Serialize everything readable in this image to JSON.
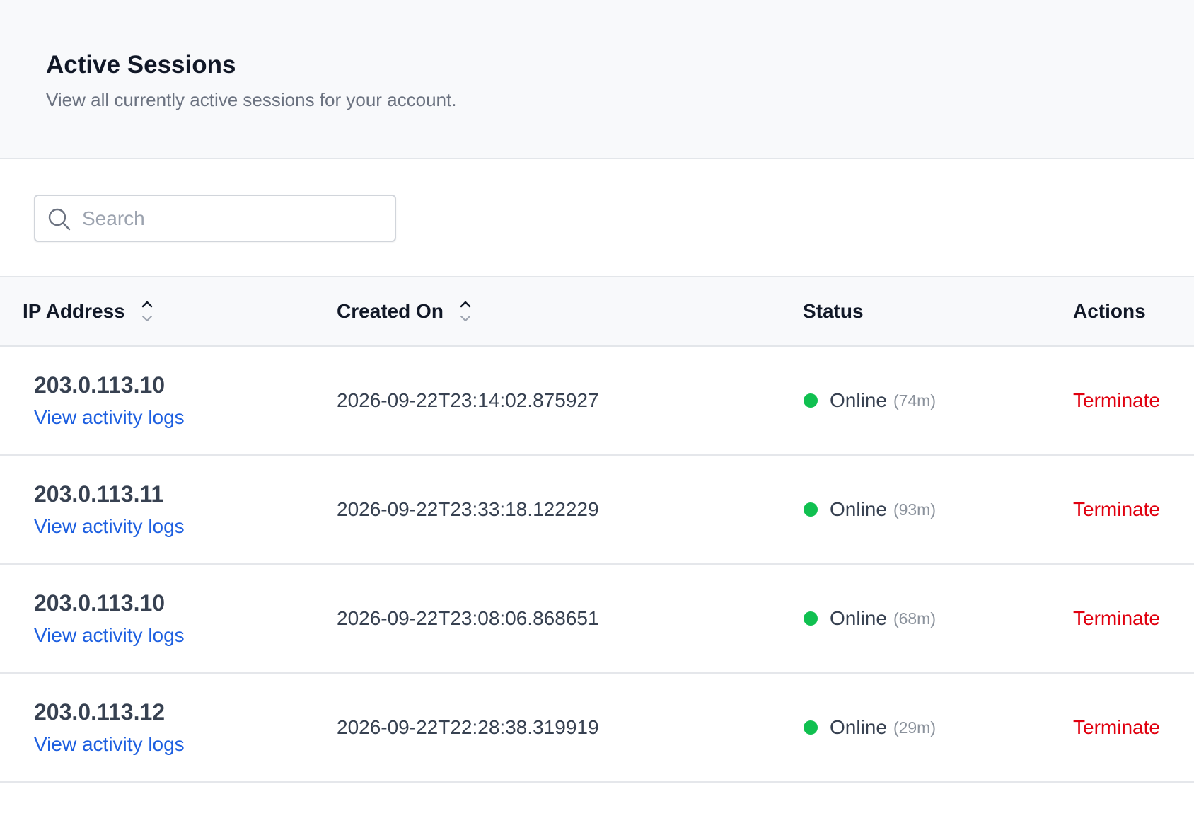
{
  "header": {
    "title": "Active Sessions",
    "subtitle": "View all currently active sessions for your account."
  },
  "search": {
    "placeholder": "Search",
    "value": ""
  },
  "table": {
    "columns": {
      "ip": "IP Address",
      "created": "Created On",
      "status": "Status",
      "actions": "Actions"
    },
    "rows": [
      {
        "ip": "203.0.113.10",
        "link": "View activity logs",
        "created": "2026-09-22T23:14:02.875927",
        "status": "Online",
        "duration": "(74m)",
        "action": "Terminate"
      },
      {
        "ip": "203.0.113.11",
        "link": "View activity logs",
        "created": "2026-09-22T23:33:18.122229",
        "status": "Online",
        "duration": "(93m)",
        "action": "Terminate"
      },
      {
        "ip": "203.0.113.10",
        "link": "View activity logs",
        "created": "2026-09-22T23:08:06.868651",
        "status": "Online",
        "duration": "(68m)",
        "action": "Terminate"
      },
      {
        "ip": "203.0.113.12",
        "link": "View activity logs",
        "created": "2026-09-22T22:28:38.319919",
        "status": "Online",
        "duration": "(29m)",
        "action": "Terminate"
      }
    ]
  },
  "icons": {
    "search": "search-icon",
    "sort": "sort-icon",
    "status": "status-dot"
  },
  "colors": {
    "link": "#1d5fe0",
    "danger": "#e0000f",
    "online": "#10c050"
  }
}
